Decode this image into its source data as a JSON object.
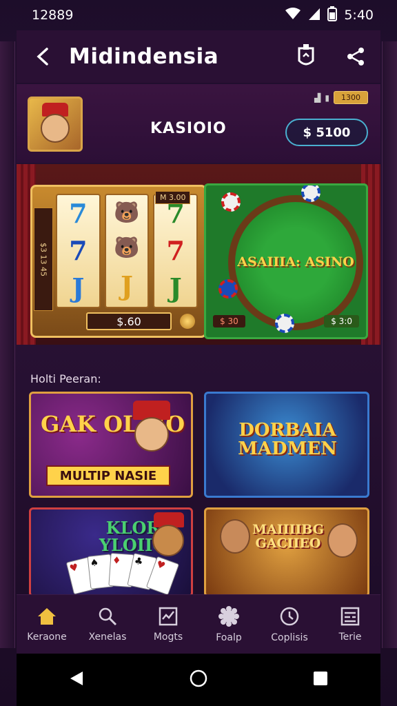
{
  "status_bar": {
    "time_left": "12889",
    "time_right": "5:40"
  },
  "app_bar": {
    "title": "Midindensia"
  },
  "header": {
    "brand": "KASIOIO",
    "mini_badge": "1300",
    "balance": "$ 5100"
  },
  "banner": {
    "slot": {
      "side_label": "$3 13 45",
      "reel_label": "M 3.00",
      "bet": "$.60",
      "reels": [
        [
          "7",
          "7",
          "J"
        ],
        [
          "🐻",
          "🐻",
          "J"
        ],
        [
          "7",
          "7",
          "J"
        ]
      ]
    },
    "table": {
      "title": "ASAIIIA: ASINO",
      "tag_left": "$ 30",
      "tag_right": "$ 3:0"
    }
  },
  "section": {
    "label": "Holti Peeran:",
    "games": [
      {
        "title": "GAK OLAIO",
        "bar": "MULTIP NASIE"
      },
      {
        "title": "DORBAIA MADMEN"
      },
      {
        "title": "KLOR YLOIIO"
      },
      {
        "title": "MAIIIIBG GACIIEO"
      }
    ]
  },
  "nav": {
    "items": [
      {
        "label": "Keraone",
        "icon": "home-icon"
      },
      {
        "label": "Xenelas",
        "icon": "search-icon"
      },
      {
        "label": "Mogts",
        "icon": "chart-icon"
      },
      {
        "label": "Foalp",
        "icon": "gear-icon"
      },
      {
        "label": "Coplisis",
        "icon": "clock-icon"
      },
      {
        "label": "Terie",
        "icon": "table-icon"
      }
    ]
  },
  "colors": {
    "accent": "#ffd24a",
    "nav_active": "#f0c040",
    "background": "#1d0d2a"
  }
}
